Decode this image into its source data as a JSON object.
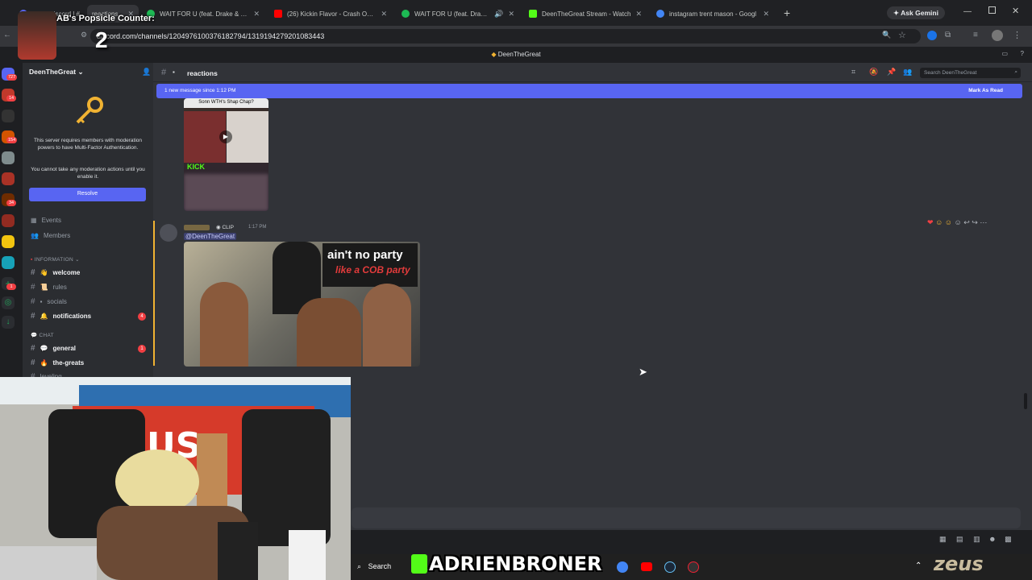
{
  "browser": {
    "tabs": [
      {
        "label": "(840) Discord | #",
        "active": false,
        "color": "#5865f2"
      },
      {
        "label": "reactions",
        "active": true,
        "color": "#5865f2"
      },
      {
        "label": "WAIT FOR U (feat. Drake & Tem",
        "active": false,
        "color": "#1db954"
      },
      {
        "label": "(26) Kickin Flavor - Crash Out B",
        "active": false,
        "color": "#ff0000"
      },
      {
        "label": "WAIT FOR U (feat. Drake &",
        "active": false,
        "color": "#1db954"
      },
      {
        "label": "DeenTheGreat Stream - Watch",
        "active": false,
        "color": "#53fc18"
      },
      {
        "label": "instagram trent mason - Googl",
        "active": false,
        "color": "#4285f4"
      }
    ],
    "ask_gemini": "Ask Gemini",
    "url": "discord.com/channels/1204976100376182794/1319194279201083443"
  },
  "discord": {
    "window_title": "DeenTheGreat",
    "server_name": "DeenTheGreat",
    "mfa_notice": "This server requires members with moderation powers to have Multi-Factor Authentication.",
    "mfa_notice2": "You cannot take any moderation actions until you enable it.",
    "resolve_label": "Resolve",
    "nav": {
      "events": "Events",
      "members": "Members"
    },
    "categories": {
      "information": "INFORMATION",
      "chat": "CHAT"
    },
    "channels": [
      {
        "name": "welcome",
        "unread": true,
        "badge": ""
      },
      {
        "name": "rules",
        "unread": false,
        "badge": ""
      },
      {
        "name": "socials",
        "unread": false,
        "badge": ""
      },
      {
        "name": "notifications",
        "unread": true,
        "badge": "4"
      },
      {
        "name": "general",
        "unread": true,
        "badge": "1"
      },
      {
        "name": "the-greats",
        "unread": true,
        "badge": ""
      },
      {
        "name": "leveling",
        "unread": false,
        "badge": ""
      }
    ],
    "server_badges": [
      "727",
      "14",
      "154",
      "34",
      "1"
    ],
    "channel_header": "reactions",
    "search_placeholder": "Search DeenTheGreat",
    "banner_text": "1 new message since 1:12 PM",
    "mark_as_read": "Mark As Read",
    "messages": [
      {
        "caption_top": "Sonn WTH's Shap Chap?",
        "overlay": "KICK"
      },
      {
        "tag": "CLIP",
        "time": "1:17 PM",
        "mention": "@DeenTheGreat",
        "image_text1": "ain't no party",
        "image_text2": "like a COB party"
      }
    ]
  },
  "overlay": {
    "popsicle_label": "AB's Popsicle Counter:",
    "popsicle_count": "2",
    "kick_name": "ADRIENBRONER",
    "watermark": "zeus"
  },
  "taskbar": {
    "search_label": "Search"
  }
}
